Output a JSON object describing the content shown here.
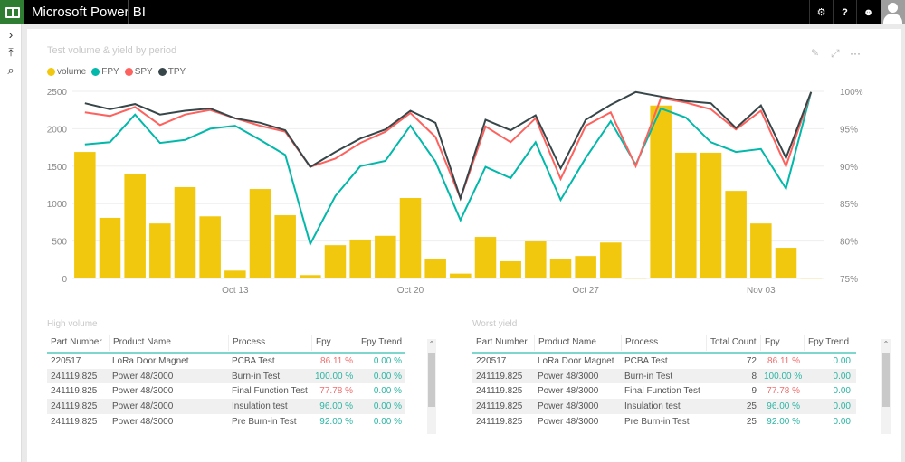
{
  "app": {
    "title": "Microsoft Power BI",
    "top_buttons": [
      {
        "name": "settings",
        "icon": "gear-icon",
        "glyph": "⚙"
      },
      {
        "name": "help",
        "icon": "help-icon",
        "glyph": "?"
      },
      {
        "name": "feedback",
        "icon": "smiley-icon",
        "glyph": "☻"
      }
    ]
  },
  "leftnav": {
    "items": [
      {
        "name": "expand",
        "icon": "chevron-right-icon",
        "glyph": "›"
      },
      {
        "name": "pin-top",
        "icon": "pin-to-top-icon",
        "glyph": "⤒"
      },
      {
        "name": "search",
        "icon": "search-icon",
        "glyph": "⌕"
      }
    ]
  },
  "visual": {
    "title": "Test volume & yield by period",
    "icons": {
      "pin": "📌",
      "focus": "⤢",
      "more": "···"
    }
  },
  "chart_data": {
    "type": "bar",
    "title": "Test volume & yield by period",
    "legend_position": "top-left",
    "legend": [
      {
        "name": "volume",
        "color": "#F2C80F"
      },
      {
        "name": "FPY",
        "color": "#01B8AA"
      },
      {
        "name": "SPY",
        "color": "#FD625E"
      },
      {
        "name": "TPY",
        "color": "#374649"
      }
    ],
    "x_tick_labels": [
      {
        "label": "Oct 13",
        "index": 6
      },
      {
        "label": "Oct 20",
        "index": 13
      },
      {
        "label": "Oct 27",
        "index": 20
      },
      {
        "label": "Nov 03",
        "index": 27
      }
    ],
    "categories_count": 30,
    "y_left": {
      "min": 0,
      "max": 2500,
      "ticks": [
        0,
        500,
        1000,
        1500,
        2000,
        2500
      ]
    },
    "y_right": {
      "min": 75,
      "max": 100,
      "ticks": [
        "75%",
        "80%",
        "85%",
        "90%",
        "95%",
        "100%"
      ]
    },
    "grid": true,
    "series": [
      {
        "name": "volume",
        "type": "bar",
        "axis": "left",
        "values": [
          1690,
          810,
          1400,
          735,
          1220,
          830,
          105,
          1195,
          845,
          45,
          445,
          520,
          570,
          1075,
          255,
          65,
          555,
          230,
          495,
          265,
          300,
          480,
          10,
          2310,
          1680,
          1680,
          1170,
          735,
          410,
          10
        ]
      },
      {
        "name": "FPY",
        "type": "line",
        "axis": "right",
        "values": [
          92.9,
          93.2,
          96.9,
          93.1,
          93.5,
          95.0,
          95.4,
          93.5,
          91.5,
          79.6,
          86.0,
          90.0,
          90.7,
          95.4,
          90.6,
          82.8,
          89.9,
          88.4,
          93.2,
          85.5,
          91.1,
          96.0,
          90.2,
          97.7,
          96.5,
          93.2,
          91.9,
          92.3,
          87.0,
          99.9
        ]
      },
      {
        "name": "SPY",
        "type": "line",
        "axis": "right",
        "values": [
          97.2,
          96.7,
          97.9,
          95.5,
          96.9,
          97.5,
          96.4,
          95.4,
          94.6,
          89.9,
          91.0,
          93.1,
          94.6,
          97.1,
          93.9,
          85.7,
          95.3,
          93.2,
          96.4,
          88.3,
          95.4,
          97.2,
          90.0,
          99.1,
          98.5,
          97.6,
          94.9,
          97.4,
          90.0,
          99.9
        ]
      },
      {
        "name": "TPY",
        "type": "line",
        "axis": "right",
        "values": [
          98.4,
          97.6,
          98.3,
          96.9,
          97.4,
          97.7,
          96.4,
          95.8,
          94.8,
          89.9,
          91.9,
          93.7,
          94.9,
          97.4,
          95.8,
          85.7,
          96.2,
          94.8,
          96.8,
          89.7,
          96.2,
          98.2,
          99.9,
          99.3,
          98.7,
          98.4,
          95.1,
          98.1,
          91.1,
          99.9
        ]
      }
    ]
  },
  "high_volume": {
    "title": "High volume",
    "columns": [
      "Part Number",
      "Product Name",
      "Process",
      "Fpy",
      "Fpy Trend"
    ],
    "rows": [
      {
        "part": "220517",
        "product": "LoRa Door Magnet",
        "process": "PCBA Test",
        "fpy": "86.11 %",
        "fpy_status": "red",
        "trend": "0.00 %"
      },
      {
        "part": "241119.825",
        "product": "Power 48/3000",
        "process": "Burn-in Test",
        "fpy": "100.00 %",
        "fpy_status": "teal",
        "trend": "0.00 %"
      },
      {
        "part": "241119.825",
        "product": "Power 48/3000",
        "process": "Final Function Test",
        "fpy": "77.78 %",
        "fpy_status": "red",
        "trend": "0.00 %"
      },
      {
        "part": "241119.825",
        "product": "Power 48/3000",
        "process": "Insulation test",
        "fpy": "96.00 %",
        "fpy_status": "teal",
        "trend": "0.00 %"
      },
      {
        "part": "241119.825",
        "product": "Power 48/3000",
        "process": "Pre Burn-in Test",
        "fpy": "92.00 %",
        "fpy_status": "teal",
        "trend": "0.00 %"
      }
    ]
  },
  "worst_yield": {
    "title": "Worst yield",
    "columns": [
      "Part Number",
      "Product Name",
      "Process",
      "Total Count",
      "Fpy",
      "Fpy Trend"
    ],
    "rows": [
      {
        "part": "220517",
        "product": "LoRa Door Magnet",
        "process": "PCBA Test",
        "count": "72",
        "fpy": "86.11 %",
        "fpy_status": "red",
        "trend": "0.00"
      },
      {
        "part": "241119.825",
        "product": "Power 48/3000",
        "process": "Burn-in Test",
        "count": "8",
        "fpy": "100.00 %",
        "fpy_status": "teal",
        "trend": "0.00"
      },
      {
        "part": "241119.825",
        "product": "Power 48/3000",
        "process": "Final Function Test",
        "count": "9",
        "fpy": "77.78 %",
        "fpy_status": "red",
        "trend": "0.00"
      },
      {
        "part": "241119.825",
        "product": "Power 48/3000",
        "process": "Insulation test",
        "count": "25",
        "fpy": "96.00 %",
        "fpy_status": "teal",
        "trend": "0.00"
      },
      {
        "part": "241119.825",
        "product": "Power 48/3000",
        "process": "Pre Burn-in Test",
        "count": "25",
        "fpy": "92.00 %",
        "fpy_status": "teal",
        "trend": "0.00"
      }
    ]
  }
}
